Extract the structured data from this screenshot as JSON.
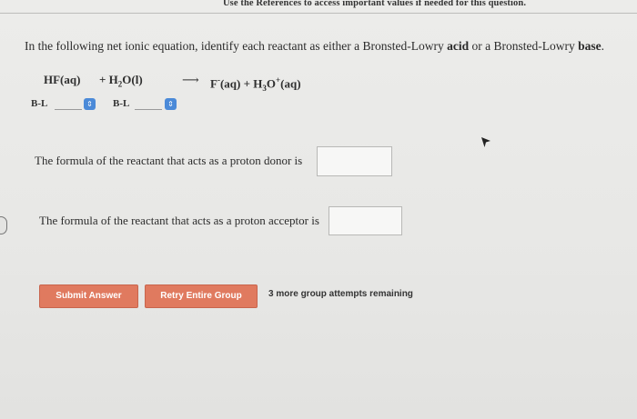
{
  "header": {
    "references_text": "Use the References to access important values if needed for this question."
  },
  "question": {
    "text_before": "In the following net ionic equation, identify each reactant as either a Bronsted-Lowry ",
    "acid_word": "acid",
    "text_middle": " or a Bronsted-Lowry ",
    "base_word": "base",
    "text_end": "."
  },
  "equation": {
    "reactant1_main": "HF(aq)",
    "plus1": "+ H",
    "h2o_sub": "2",
    "h2o_rest": "O(l)",
    "arrow": "⟶",
    "product_f": "F",
    "product_f_sup": "-",
    "product_f_rest": "(aq) + H",
    "h3o_sub": "3",
    "h3o_o": "O",
    "h3o_sup": "+",
    "h3o_rest": "(aq)"
  },
  "selectors": {
    "label_1": "B-L",
    "label_2": "B-L",
    "stepper_icon": "⇕"
  },
  "prompts": {
    "proton_donor": "The formula of the reactant that acts as a proton donor is",
    "proton_acceptor": "The formula of the reactant that acts as a proton acceptor is"
  },
  "buttons": {
    "submit": "Submit Answer",
    "retry": "Retry Entire Group"
  },
  "attempts_text": "3 more group attempts remaining",
  "colors": {
    "button_bg": "#e07a5f",
    "stepper_bg": "#4b8ad8"
  }
}
